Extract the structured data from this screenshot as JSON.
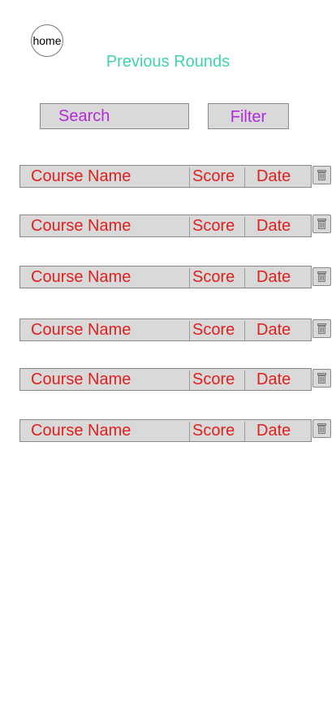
{
  "header": {
    "home_label": "home",
    "title": "Previous Rounds"
  },
  "controls": {
    "search_label": "Search",
    "filter_label": "Filter"
  },
  "rounds": [
    {
      "course": "Course Name",
      "score": "Score",
      "date": "Date",
      "delete_icon": "trash-icon"
    },
    {
      "course": "Course Name",
      "score": "Score",
      "date": "Date",
      "delete_icon": "trash-icon"
    },
    {
      "course": "Course Name",
      "score": "Score",
      "date": "Date",
      "delete_icon": "trash-icon"
    },
    {
      "course": "Course Name",
      "score": "Score",
      "date": "Date",
      "delete_icon": "trash-icon"
    },
    {
      "course": "Course Name",
      "score": "Score",
      "date": "Date",
      "delete_icon": "trash-icon"
    },
    {
      "course": "Course Name",
      "score": "Score",
      "date": "Date",
      "delete_icon": "trash-icon"
    }
  ],
  "colors": {
    "title": "#3fd3b0",
    "controls_text": "#b12bdc",
    "row_text": "#e0201e",
    "field_background": "#d9d9d9"
  }
}
